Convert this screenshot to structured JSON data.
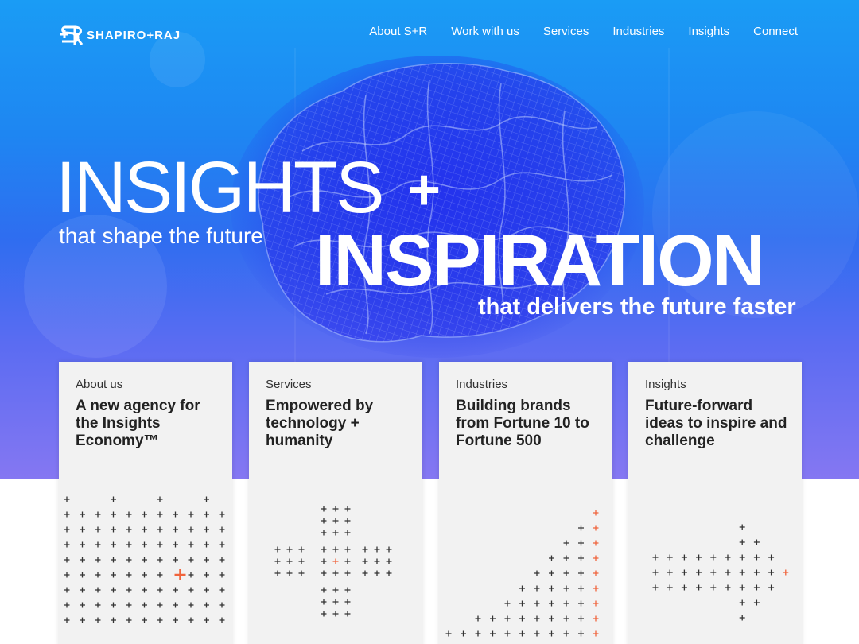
{
  "brand": {
    "name": "SHAPIRO+RAJ",
    "logo_icon": "sr-monogram-icon"
  },
  "nav": {
    "items": [
      "About S+R",
      "Work with us",
      "Services",
      "Industries",
      "Insights",
      "Connect"
    ]
  },
  "hero": {
    "headline_1": "INSIGHTS",
    "plus": "+",
    "sub_1": "that shape the future",
    "headline_2": "INSPIRATION",
    "sub_2": "that delivers the future faster"
  },
  "cards": [
    {
      "category": "About us",
      "title": "A new agency for the Insights Economy™"
    },
    {
      "category": "Services",
      "title": "Empowered by technology + humanity"
    },
    {
      "category": "Industries",
      "title": "Building brands from Fortune 10 to Fortune 500"
    },
    {
      "category": "Insights",
      "title": "Future-forward ideas to inspire and challenge"
    }
  ],
  "colors": {
    "hero_top": "#1a9cf5",
    "hero_bottom": "#8577f2",
    "card_bg": "#f2f2f2",
    "plus_dark": "#333333",
    "plus_accent": "#f0643c"
  }
}
